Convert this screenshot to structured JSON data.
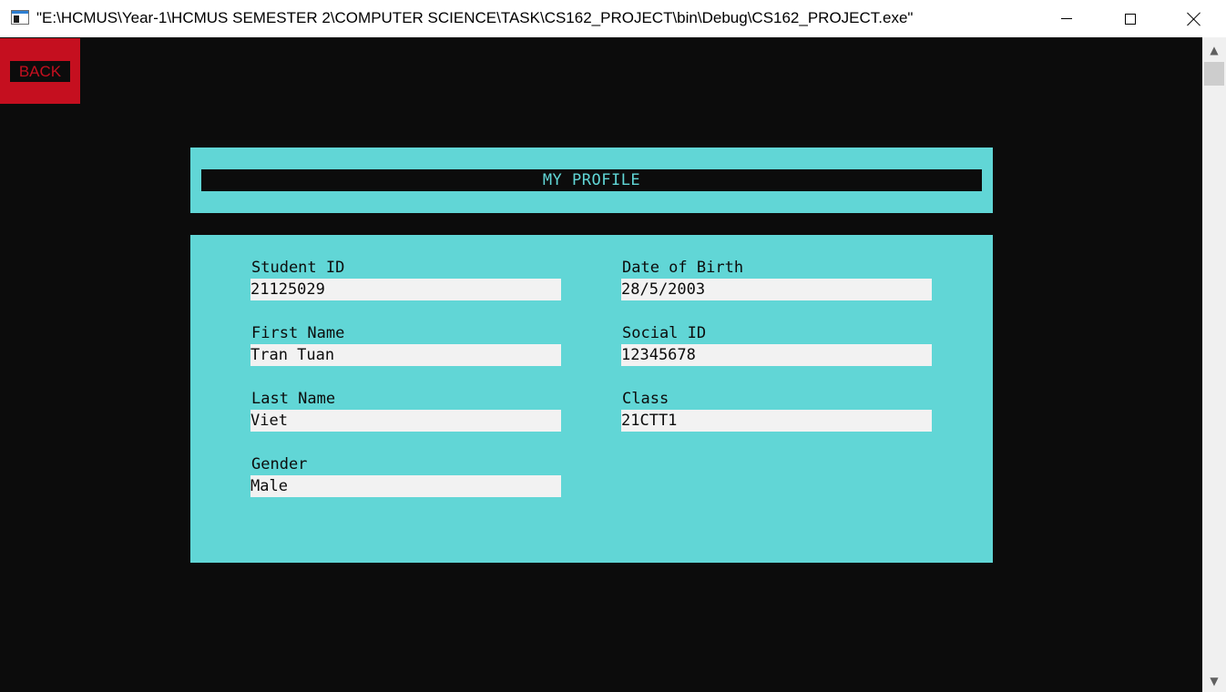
{
  "window": {
    "title": "\"E:\\HCMUS\\Year-1\\HCMUS SEMESTER 2\\COMPUTER SCIENCE\\TASK\\CS162_PROJECT\\bin\\Debug\\CS162_PROJECT.exe\"",
    "icon": "console-app-icon"
  },
  "colors": {
    "console_bg": "#0c0c0c",
    "accent_red": "#c50f1f",
    "panel_cyan": "#61d6d6",
    "field_bg": "#f2f2f2"
  },
  "back_button": {
    "label": "BACK"
  },
  "header": {
    "title": "MY PROFILE"
  },
  "profile": {
    "student_id": {
      "label": "Student ID",
      "value": "21125029"
    },
    "first_name": {
      "label": "First Name",
      "value": "Tran Tuan"
    },
    "last_name": {
      "label": "Last Name",
      "value": "Viet"
    },
    "gender": {
      "label": "Gender",
      "value": "Male"
    },
    "date_of_birth": {
      "label": "Date of Birth",
      "value": "28/5/2003"
    },
    "social_id": {
      "label": "Social ID",
      "value": "12345678"
    },
    "class": {
      "label": "Class",
      "value": "21CTT1"
    }
  }
}
